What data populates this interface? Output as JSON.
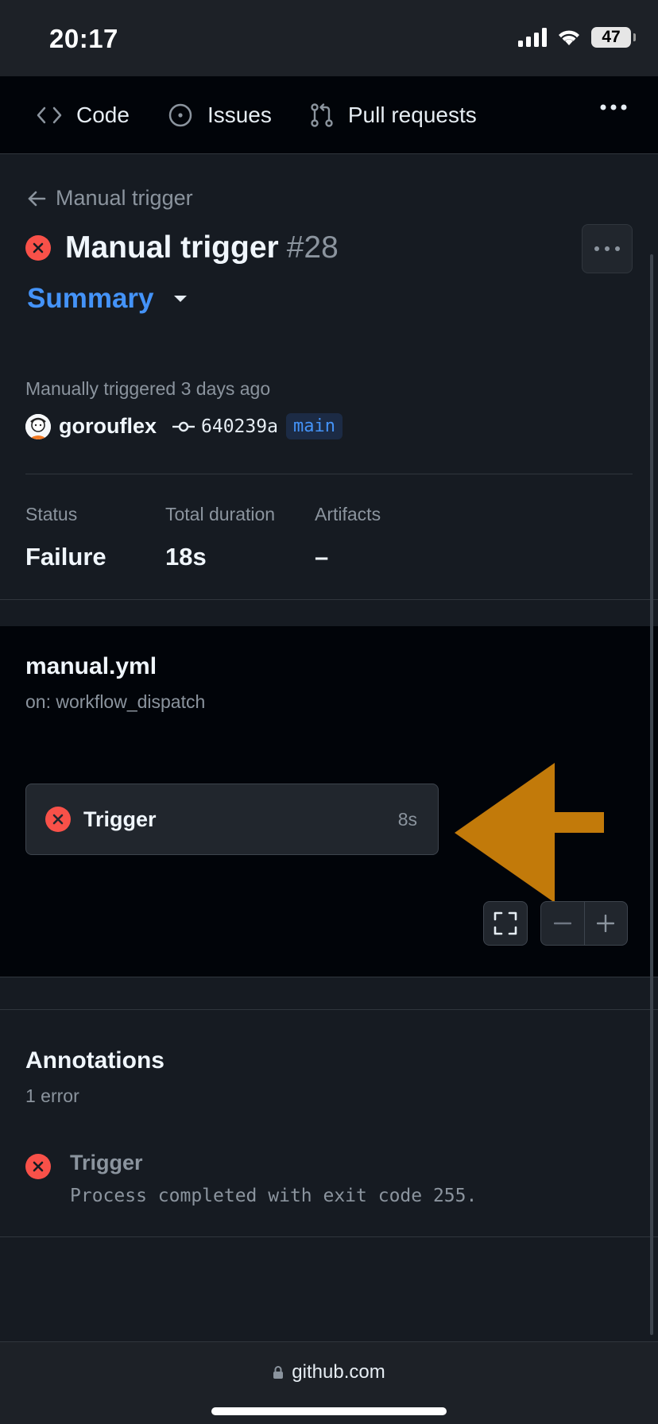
{
  "status_bar": {
    "time": "20:17",
    "battery": "47"
  },
  "repo_nav": {
    "items": [
      {
        "label": "Code",
        "icon": "code-icon"
      },
      {
        "label": "Issues",
        "icon": "issue-opened-icon"
      },
      {
        "label": "Pull requests",
        "icon": "git-pull-request-icon"
      }
    ],
    "more_icon": "kebab-horizontal-icon"
  },
  "run": {
    "back_label": "Manual trigger",
    "title": "Manual trigger",
    "number": "#28",
    "status_icon": "x-circle-fill-icon",
    "view_selector": "Summary",
    "triggered_text": "Manually triggered 3 days ago",
    "actor": "gorouflex",
    "commit_sha": "640239a",
    "branch": "main"
  },
  "stats": {
    "status_label": "Status",
    "status_value": "Failure",
    "duration_label": "Total duration",
    "duration_value": "18s",
    "artifacts_label": "Artifacts",
    "artifacts_value": "–"
  },
  "workflow": {
    "file": "manual.yml",
    "trigger": "on: workflow_dispatch",
    "job": {
      "name": "Trigger",
      "duration": "8s"
    }
  },
  "annotations": {
    "title": "Annotations",
    "count": "1 error",
    "items": [
      {
        "job": "Trigger",
        "message": "Process completed with exit code 255."
      }
    ]
  },
  "browser": {
    "url": "github.com"
  },
  "colors": {
    "failure": "#f85149",
    "link": "#4493f8",
    "annotation_arrow": "#c27a0a"
  }
}
